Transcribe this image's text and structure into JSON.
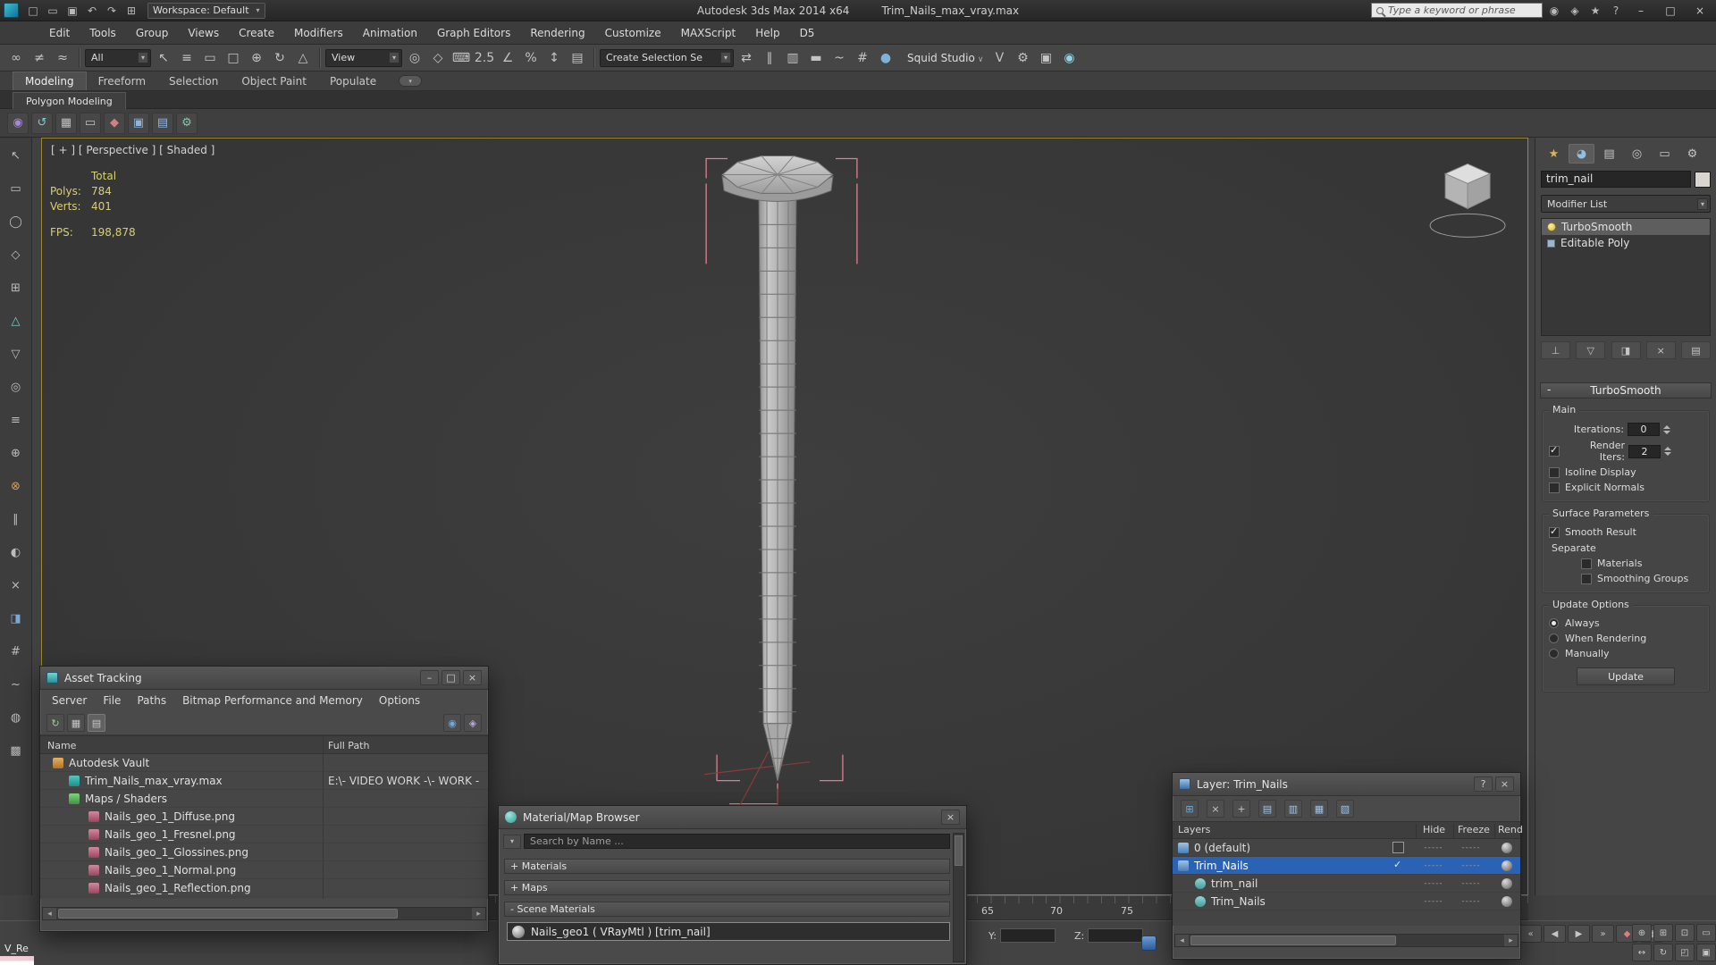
{
  "colors": {
    "accent_blue": "#2a63b5",
    "viewport_border": "#9a8738",
    "stats_yellow": "#d9cf6e",
    "selection_pink": "#e07f93"
  },
  "window_controls": {
    "minimize": "–",
    "maximize": "□",
    "close": "×",
    "help": "?"
  },
  "titlebar": {
    "workspace_label": "Workspace: Default",
    "app_title": "Autodesk 3ds Max 2014 x64",
    "file_title": "Trim_Nails_max_vray.max",
    "search_placeholder": "Type a keyword or phrase",
    "left_icons": [
      {
        "name": "new-scene-icon",
        "glyph": "□"
      },
      {
        "name": "open-file-icon",
        "glyph": "▭"
      },
      {
        "name": "save-file-icon",
        "glyph": "▣"
      },
      {
        "name": "undo-icon",
        "glyph": "↶"
      },
      {
        "name": "redo-icon",
        "glyph": "↷"
      },
      {
        "name": "project-folder-icon",
        "glyph": "⊞"
      }
    ],
    "right_icons": [
      {
        "name": "sign-in-icon",
        "glyph": "◉"
      },
      {
        "name": "community-icon",
        "glyph": "◈"
      },
      {
        "name": "favorites-star-icon",
        "glyph": "★"
      },
      {
        "name": "help-icon",
        "glyph": "?"
      }
    ]
  },
  "menubar": {
    "items": [
      "Edit",
      "Tools",
      "Group",
      "Views",
      "Create",
      "Modifiers",
      "Animation",
      "Graph Editors",
      "Rendering",
      "Customize",
      "MAXScript",
      "Help",
      "D5"
    ]
  },
  "toolbar": {
    "selection_filter": "All",
    "coord_system": "View",
    "named_selection": "Create Selection Se",
    "studio_label": "Squid Studio",
    "icons_a": [
      {
        "name": "select-and-link-icon",
        "glyph": "∞"
      },
      {
        "name": "unlink-selection-icon",
        "glyph": "≠"
      },
      {
        "name": "bind-to-spacewarp-icon",
        "glyph": "≈"
      }
    ],
    "icons_b": [
      {
        "name": "select-object-icon",
        "glyph": "↖"
      },
      {
        "name": "select-by-name-icon",
        "glyph": "≡"
      },
      {
        "name": "selection-region-icon",
        "glyph": "▭"
      },
      {
        "name": "window-crossing-icon",
        "glyph": "□"
      },
      {
        "name": "select-and-move-icon",
        "glyph": "⊕"
      },
      {
        "name": "select-and-rotate-icon",
        "glyph": "↻"
      },
      {
        "name": "select-and-scale-icon",
        "glyph": "△"
      }
    ],
    "icons_c": [
      {
        "name": "use-pivot-center-icon",
        "glyph": "◎"
      },
      {
        "name": "select-and-manipulate-icon",
        "glyph": "◇"
      },
      {
        "name": "keyboard-override-icon",
        "glyph": "⌨"
      },
      {
        "name": "snap-toggle-icon",
        "glyph": "2.5"
      },
      {
        "name": "angle-snap-icon",
        "glyph": "∠"
      },
      {
        "name": "percent-snap-icon",
        "glyph": "%"
      },
      {
        "name": "spinner-snap-icon",
        "glyph": "↕"
      },
      {
        "name": "named-selection-sets-icon",
        "glyph": "▤"
      }
    ],
    "icons_d": [
      {
        "name": "mirror-icon",
        "glyph": "⇄"
      },
      {
        "name": "align-icon",
        "glyph": "∥"
      },
      {
        "name": "layer-manager-icon",
        "glyph": "▥"
      },
      {
        "name": "ribbon-toggle-icon",
        "glyph": "▬"
      },
      {
        "name": "curve-editor-icon",
        "glyph": "~"
      },
      {
        "name": "schematic-view-icon",
        "glyph": "#"
      },
      {
        "name": "material-editor-icon",
        "glyph": "●",
        "color": "#7fb2d8"
      }
    ],
    "icons_e": [
      {
        "name": "vray-studio-icon",
        "glyph": "V"
      },
      {
        "name": "render-setup-icon",
        "glyph": "⚙"
      },
      {
        "name": "rendered-frame-icon",
        "glyph": "▣"
      },
      {
        "name": "render-production-icon",
        "glyph": "◉",
        "color": "#8fd4e8"
      }
    ]
  },
  "ribbon": {
    "tabs": [
      {
        "label": "Modeling",
        "active": true
      },
      {
        "label": "Freeform"
      },
      {
        "label": "Selection"
      },
      {
        "label": "Object Paint"
      },
      {
        "label": "Populate"
      }
    ],
    "subtab": "Polygon Modeling",
    "icons": [
      {
        "name": "polygon-mode-icon",
        "glyph": "◉",
        "color": "#a887d8"
      },
      {
        "name": "repeat-last-icon",
        "glyph": "↺",
        "color": "#7fc9c9"
      },
      {
        "name": "generate-topology-icon",
        "glyph": "▦"
      },
      {
        "name": "symmetry-tools-icon",
        "glyph": "▭"
      },
      {
        "name": "object-properties-icon",
        "glyph": "◆",
        "color": "#d08080"
      },
      {
        "name": "edit-poly-icon",
        "glyph": "▣",
        "color": "#8fb4d8"
      },
      {
        "name": "modifier-panel-icon",
        "glyph": "▤",
        "color": "#8fb4d8"
      },
      {
        "name": "settings-gear-icon",
        "glyph": "⚙",
        "color": "#7fc9a8"
      }
    ]
  },
  "left_toolbar": {
    "icons": [
      {
        "name": "select-tool-icon",
        "glyph": "↖"
      },
      {
        "name": "region-rect-icon",
        "glyph": "▭"
      },
      {
        "name": "region-circle-icon",
        "glyph": "◯"
      },
      {
        "name": "region-fence-icon",
        "glyph": "◇"
      },
      {
        "name": "region-paint-icon",
        "glyph": "⊞"
      },
      {
        "name": "grow-selection-icon",
        "glyph": "△",
        "color": "#7fc9c9"
      },
      {
        "name": "shrink-selection-icon",
        "glyph": "▽"
      },
      {
        "name": "loop-select-icon",
        "glyph": "◎"
      },
      {
        "name": "ring-select-icon",
        "glyph": "≡"
      },
      {
        "name": "extrude-tool-icon",
        "glyph": "⊕"
      },
      {
        "name": "bevel-tool-icon",
        "glyph": "⊗",
        "color": "#d0a060"
      },
      {
        "name": "bridge-tool-icon",
        "glyph": "∥"
      },
      {
        "name": "chamfer-tool-icon",
        "glyph": "◐"
      },
      {
        "name": "cut-tool-icon",
        "glyph": "×"
      },
      {
        "name": "slice-tool-icon",
        "glyph": "◨",
        "color": "#7fa8d0"
      },
      {
        "name": "swiftloop-tool-icon",
        "glyph": "#"
      },
      {
        "name": "paint-deform-icon",
        "glyph": "~"
      },
      {
        "name": "relax-tool-icon",
        "glyph": "◍"
      },
      {
        "name": "constraints-icon",
        "glyph": "▩"
      }
    ]
  },
  "viewport": {
    "label": "[ + ] [ Perspective ] [ Shaded ]",
    "stats": {
      "total_label": "Total",
      "polys_label": "Polys:",
      "polys": "784",
      "verts_label": "Verts:",
      "verts": "401",
      "fps_label": "FPS:",
      "fps": "198,878"
    }
  },
  "command_panel": {
    "object_name": "trim_nail",
    "modifier_list_label": "Modifier List",
    "tabs": [
      {
        "name": "create-tab",
        "glyph": "★",
        "color": "#d8b45f"
      },
      {
        "name": "modify-tab",
        "glyph": "◕",
        "color": "#8fc1e8",
        "active": true
      },
      {
        "name": "hierarchy-tab",
        "glyph": "▤"
      },
      {
        "name": "motion-tab",
        "glyph": "◎"
      },
      {
        "name": "display-tab",
        "glyph": "▭"
      },
      {
        "name": "utilities-tab",
        "glyph": "⚙"
      }
    ],
    "stack": [
      {
        "label": "TurboSmooth",
        "icon": "lightbulb",
        "selected": true
      },
      {
        "label": "Editable Poly",
        "icon": "poly"
      }
    ],
    "stack_buttons": [
      {
        "name": "pin-stack-button",
        "glyph": "⊥"
      },
      {
        "name": "show-end-result-button",
        "glyph": "▽"
      },
      {
        "name": "make-unique-button",
        "glyph": "◨"
      },
      {
        "name": "remove-modifier-button",
        "glyph": "×"
      },
      {
        "name": "configure-sets-button",
        "glyph": "▤"
      }
    ],
    "turbosmooth": {
      "title": "TurboSmooth",
      "main_label": "Main",
      "iterations_label": "Iterations:",
      "iterations_value": "0",
      "render_iters_label": "Render Iters:",
      "render_iters_value": "2",
      "isoline_label": "Isoline Display",
      "explicit_label": "Explicit Normals",
      "surface_label": "Surface Parameters",
      "smooth_result_label": "Smooth Result",
      "separate_label": "Separate",
      "materials_label": "Materials",
      "smoothing_groups_label": "Smoothing Groups",
      "update_options_label": "Update Options",
      "always_label": "Always",
      "when_rendering_label": "When Rendering",
      "manually_label": "Manually",
      "update_button": "Update"
    }
  },
  "asset_tracking": {
    "title": "Asset Tracking",
    "menu": [
      "Server",
      "File",
      "Paths",
      "Bitmap Performance and Memory",
      "Options"
    ],
    "toolbar": [
      {
        "name": "refresh-icon",
        "glyph": "↻",
        "color": "#8fd48f"
      },
      {
        "name": "details-view-icon",
        "glyph": "▦"
      },
      {
        "name": "table-view-icon",
        "glyph": "▤",
        "active": true
      }
    ],
    "toolbar_right": [
      {
        "name": "status-refresh-icon",
        "glyph": "◉",
        "color": "#6fa8dc"
      },
      {
        "name": "options-icon",
        "glyph": "◈",
        "color": "#b8a8d8"
      }
    ],
    "columns": [
      "Name",
      "Full Path"
    ],
    "rows": [
      {
        "name": "Autodesk Vault",
        "path": "",
        "indent": 1,
        "icon": "vault"
      },
      {
        "name": "Trim_Nails_max_vray.max",
        "path": "E:\\- VIDEO WORK -\\- WORK -",
        "indent": 2,
        "icon": "maxfile"
      },
      {
        "name": "Maps / Shaders",
        "path": "",
        "indent": 2,
        "icon": "maps"
      },
      {
        "name": "Nails_geo_1_Diffuse.png",
        "path": "",
        "indent": 3,
        "icon": "png"
      },
      {
        "name": "Nails_geo_1_Fresnel.png",
        "path": "",
        "indent": 3,
        "icon": "png"
      },
      {
        "name": "Nails_geo_1_Glossines.png",
        "path": "",
        "indent": 3,
        "icon": "png"
      },
      {
        "name": "Nails_geo_1_Normal.png",
        "path": "",
        "indent": 3,
        "icon": "png"
      },
      {
        "name": "Nails_geo_1_Reflection.png",
        "path": "",
        "indent": 3,
        "icon": "png"
      }
    ]
  },
  "material_browser": {
    "title": "Material/Map Browser",
    "search_placeholder": "Search by Name ...",
    "groups": [
      {
        "label": "+ Materials"
      },
      {
        "label": "+ Maps"
      },
      {
        "label": "- Scene Materials"
      }
    ],
    "scene_material": "Nails_geo1  ( VRayMtl )  [trim_nail]"
  },
  "layer_window": {
    "title": "Layer:  Trim_Nails",
    "toolbar": [
      {
        "name": "new-layer-icon",
        "glyph": "⊞",
        "color": "#6fa8dc"
      },
      {
        "name": "delete-layer-icon",
        "glyph": "×"
      },
      {
        "name": "add-to-layer-icon",
        "glyph": "+"
      },
      {
        "name": "select-layer-objects-icon",
        "glyph": "▤",
        "color": "#9fc4e8"
      },
      {
        "name": "set-current-layer-icon",
        "glyph": "▥",
        "color": "#9fc4e8"
      },
      {
        "name": "hide-all-icon",
        "glyph": "▦",
        "color": "#9fc4e8"
      },
      {
        "name": "freeze-all-icon",
        "glyph": "▧",
        "color": "#9fc4e8"
      }
    ],
    "columns": [
      "Layers",
      "Hide",
      "Freeze",
      "Rend"
    ],
    "rows": [
      {
        "name": "0 (default)",
        "icon": "layer",
        "mark": "box",
        "hide": "-----",
        "freeze": "-----",
        "indent": 0
      },
      {
        "name": "Trim_Nails",
        "icon": "layer",
        "mark": "check",
        "hide": "-----",
        "freeze": "-----",
        "indent": 0,
        "selected": true
      },
      {
        "name": "trim_nail",
        "icon": "object",
        "hide": "-----",
        "freeze": "-----",
        "indent": 1
      },
      {
        "name": "Trim_Nails",
        "icon": "object",
        "hide": "-----",
        "freeze": "-----",
        "indent": 1
      }
    ]
  },
  "trackbar": {
    "n1": "65",
    "n2": "70",
    "n3": "75"
  },
  "statusbar": {
    "y_label": "Y:",
    "z_label": "Z:",
    "left_label": "V_Re",
    "playback": [
      {
        "name": "go-to-start-button",
        "glyph": "«"
      },
      {
        "name": "prev-frame-button",
        "glyph": "◀"
      },
      {
        "name": "play-button",
        "glyph": "▶"
      },
      {
        "name": "next-frame-button",
        "glyph": "»"
      },
      {
        "name": "key-mode-button",
        "glyph": "◆",
        "color": "#d87f7f"
      },
      {
        "name": "time-config-button",
        "glyph": "▦"
      }
    ],
    "nav": [
      {
        "name": "zoom-icon",
        "glyph": "⊕"
      },
      {
        "name": "zoom-all-icon",
        "glyph": "⊞"
      },
      {
        "name": "zoom-extents-icon",
        "glyph": "⊡"
      },
      {
        "name": "fov-icon",
        "glyph": "▭"
      },
      {
        "name": "pan-icon",
        "glyph": "↔"
      },
      {
        "name": "orbit-icon",
        "glyph": "↻"
      },
      {
        "name": "region-zoom-icon",
        "glyph": "◰"
      },
      {
        "name": "maximize-viewport-icon",
        "glyph": "▣"
      }
    ]
  }
}
